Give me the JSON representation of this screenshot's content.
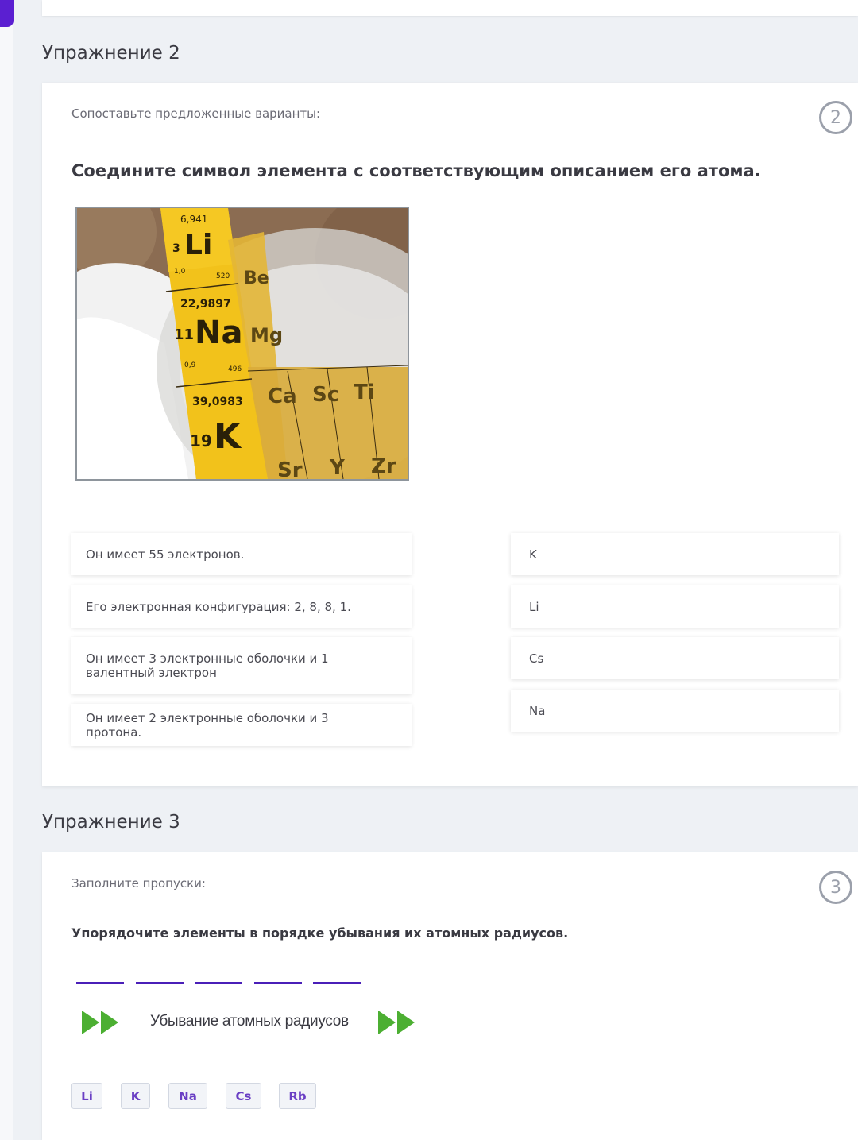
{
  "exercise2": {
    "title": "Упражнение 2",
    "instruction": "Сопоставьте предложенные варианты:",
    "number": "2",
    "question": "Соедините символ элемента с соответствующим описанием его атома.",
    "image": {
      "cells": [
        "6,941",
        "3",
        "Li",
        "1,0",
        "520",
        "22,9897",
        "11",
        "Na",
        "0,9",
        "496",
        "39,0983",
        "19",
        "K",
        "Be",
        "Mg",
        "Ca",
        "Sc",
        "Ti",
        "Sr",
        "Y",
        "Zr"
      ]
    },
    "left_items": [
      "Он имеет 55 электронов.",
      "Его электронная конфигурация: 2, 8, 8, 1.",
      "Он имеет 3 электронные оболочки и 1 валентный электрон",
      "Он имеет 2 электронные оболочки и 3 протона."
    ],
    "right_items": [
      "K",
      "Li",
      "Cs",
      "Na"
    ]
  },
  "exercise3": {
    "title": "Упражнение 3",
    "instruction": "Заполните пропуски:",
    "number": "3",
    "question": "Упорядочите элементы в порядке убывания их атомных радиусов.",
    "blank_count": 5,
    "arrow_label": "Убывание атомных радиусов",
    "chips": [
      "Li",
      "K",
      "Na",
      "Cs",
      "Rb"
    ]
  },
  "colors": {
    "accent_purple": "#5b1fd1",
    "blank_line": "#4a1fb8",
    "chip_text": "#6a3fc4",
    "arrow_green": "#4caf32",
    "badge_grey": "#9ba0ab"
  }
}
